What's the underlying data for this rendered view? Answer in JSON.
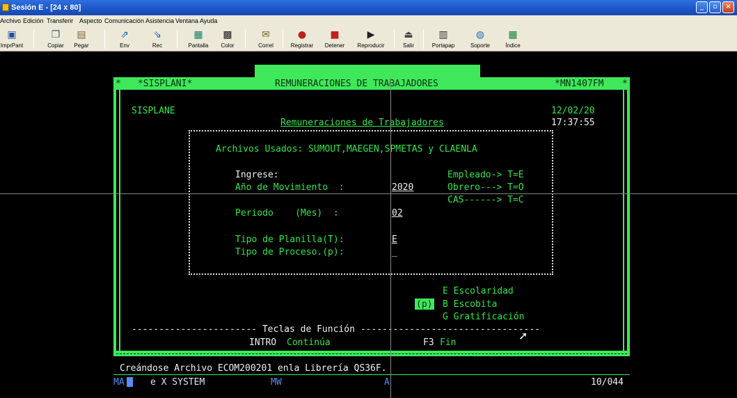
{
  "window": {
    "title": "Sesión E - [24 x 80]"
  },
  "menu": [
    "Archivo",
    "Edición",
    "Transferir",
    "Aspecto",
    "Comunicación",
    "Asistencia",
    "Ventana",
    "Ayuda"
  ],
  "toolbar": [
    {
      "label": "ImprPant",
      "icon": "print-screen-icon"
    },
    {
      "label": "Copiar",
      "icon": "copy-icon"
    },
    {
      "label": "Pegar",
      "icon": "paste-icon"
    },
    {
      "label": "Env",
      "icon": "send-icon"
    },
    {
      "label": "Rec",
      "icon": "receive-icon"
    },
    {
      "label": "Pantalla",
      "icon": "display-icon"
    },
    {
      "label": "Color",
      "icon": "color-icon"
    },
    {
      "label": "Correl",
      "icon": "mail-icon"
    },
    {
      "label": "Registrar",
      "icon": "record-icon"
    },
    {
      "label": "Detener",
      "icon": "stop-icon"
    },
    {
      "label": "Reproducir",
      "icon": "play-icon"
    },
    {
      "label": "Salir",
      "icon": "exit-icon"
    },
    {
      "label": "Portapap",
      "icon": "clipboard-icon"
    },
    {
      "label": "Soporte",
      "icon": "globe-icon"
    },
    {
      "label": "Índice",
      "icon": "index-icon"
    }
  ],
  "screen": {
    "header_left": "*SISPLANI*",
    "header_title": "REMUNERACIONES DE TRABAJADORES",
    "header_right": "*MN1407FM",
    "corner_mark": "*",
    "system": "SISPLANE",
    "subtitle": "Remuneraciones de Trabajadores",
    "date": "12/02/20",
    "time": "17:37:55",
    "files_used": "Archivos Usados: SUMOUT,MAEGEN,SPMETAS y CLAENLA",
    "ingrese": "Ingrese:",
    "year_label": "Año de Movimiento  :",
    "year_value": "2020",
    "period_label": "Periodo    (Mes)  :",
    "period_value": "02",
    "planilla_label": "Tipo de Planilla(T):",
    "planilla_value": "E",
    "proceso_label": "Tipo de Proceso.(p):",
    "proceso_value": "_",
    "hint_empleado": "Empleado-> T=E",
    "hint_obrero": "Obrero---> T=O",
    "hint_cas": "CAS------> T=C",
    "opt_e": "E Escolaridad",
    "opt_p": "(p)",
    "opt_b": "B Escobita",
    "opt_g": "G Gratificación",
    "func_line": "----------------------- Teclas de Función ---------------------------------",
    "intro_key": "INTRO",
    "intro_desc": "Continúa",
    "f3_key": "F3",
    "f3_desc": "Fin",
    "message": "Creándose Archivo ECOM200201 enla Librería QS36F."
  },
  "oia": {
    "ma": "MA",
    "system": "e X SYSTEM",
    "mw": "MW",
    "a": "A",
    "pos": "10/044"
  },
  "colors": {
    "green": "#3ee85a",
    "white": "#f0f0f0",
    "blue": "#5a8cf0"
  }
}
